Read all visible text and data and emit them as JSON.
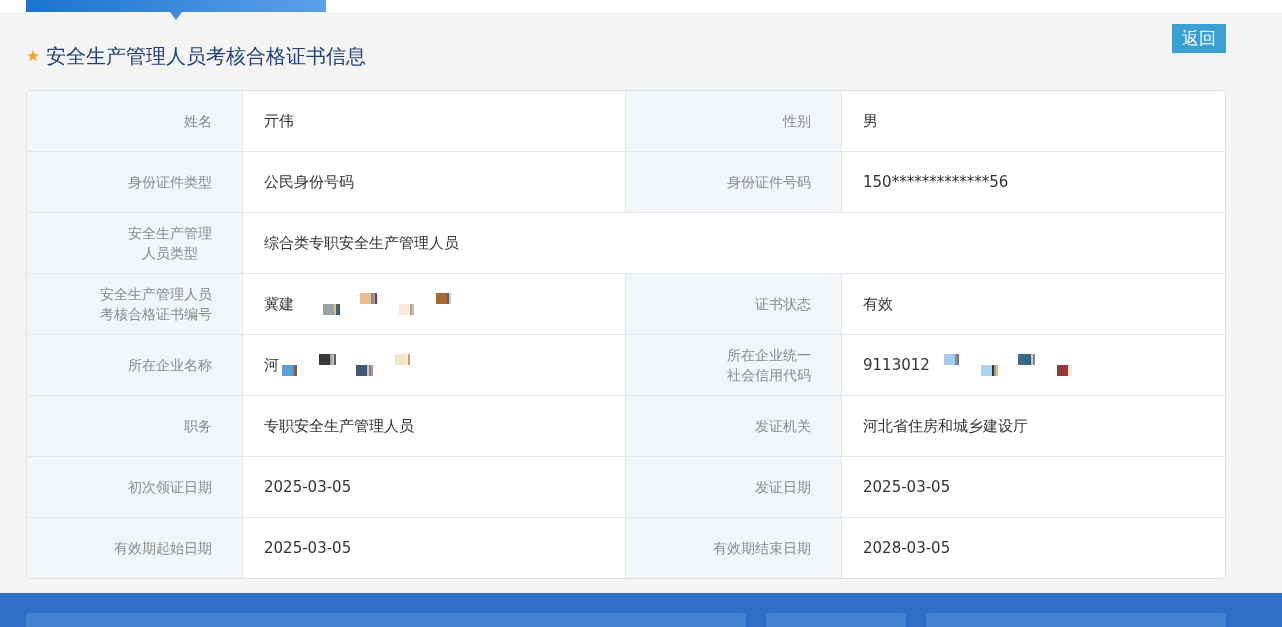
{
  "title": "安全生产管理人员考核合格证书信息",
  "back_button": "返回",
  "rows": [
    {
      "cells": [
        {
          "label": [
            "姓名"
          ],
          "value": "亓伟"
        },
        {
          "label": [
            "性别"
          ],
          "value": "男"
        }
      ]
    },
    {
      "cells": [
        {
          "label": [
            "身份证件类型"
          ],
          "value": "公民身份号码"
        },
        {
          "label": [
            "身份证件号码"
          ],
          "value": "150*************56"
        }
      ]
    },
    {
      "cells": [
        {
          "label": [
            "安全生产管理",
            "人员类型"
          ],
          "value": "综合类专职安全生产管理人员"
        }
      ]
    },
    {
      "cells": [
        {
          "label": [
            "安全生产管理人员",
            "考核合格证书编号"
          ],
          "value": "冀建",
          "redacted": true
        },
        {
          "label": [
            "证书状态"
          ],
          "value": "有效"
        }
      ]
    },
    {
      "cells": [
        {
          "label": [
            "所在企业名称"
          ],
          "value": "河",
          "redacted": true
        },
        {
          "label": [
            "所在企业统一",
            "社会信用代码"
          ],
          "value": "9113012",
          "redacted": true
        }
      ]
    },
    {
      "cells": [
        {
          "label": [
            "职务"
          ],
          "value": "专职安全生产管理人员"
        },
        {
          "label": [
            "发证机关"
          ],
          "value": "河北省住房和城乡建设厅"
        }
      ]
    },
    {
      "cells": [
        {
          "label": [
            "初次领证日期"
          ],
          "value": "2025-03-05"
        },
        {
          "label": [
            "发证日期"
          ],
          "value": "2025-03-05"
        }
      ]
    },
    {
      "cells": [
        {
          "label": [
            "有效期起始日期"
          ],
          "value": "2025-03-05"
        },
        {
          "label": [
            "有效期结束日期"
          ],
          "value": "2028-03-05"
        }
      ]
    }
  ]
}
